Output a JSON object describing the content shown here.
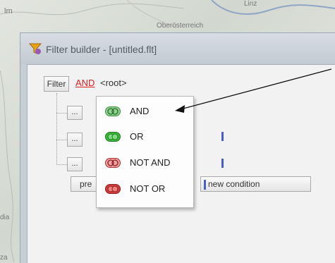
{
  "background_map": {
    "labels": [
      "lm",
      "Linz",
      "Oberösterreich",
      "dia",
      "za"
    ]
  },
  "window": {
    "title": "Filter builder - [untitled.flt]"
  },
  "filter": {
    "filter_button": "Filter",
    "group_operator": "AND",
    "root_label": "<root>",
    "condition_buttons": [
      "...",
      "...",
      "..."
    ],
    "bottom_left_button": "pre",
    "bottom_right_button": "new condition"
  },
  "operator_menu": {
    "items": [
      {
        "label": "AND",
        "icon": "and-operator-icon",
        "color": "#5cb85c"
      },
      {
        "label": "OR",
        "icon": "or-operator-icon",
        "color": "#3cb83c"
      },
      {
        "label": "NOT AND",
        "icon": "not-and-operator-icon",
        "color": "#d94a4a"
      },
      {
        "label": "NOT OR",
        "icon": "not-or-operator-icon",
        "color": "#d93a3a"
      }
    ]
  },
  "colors": {
    "accent_red": "#d32222",
    "title_bar": "#c7ced6"
  }
}
